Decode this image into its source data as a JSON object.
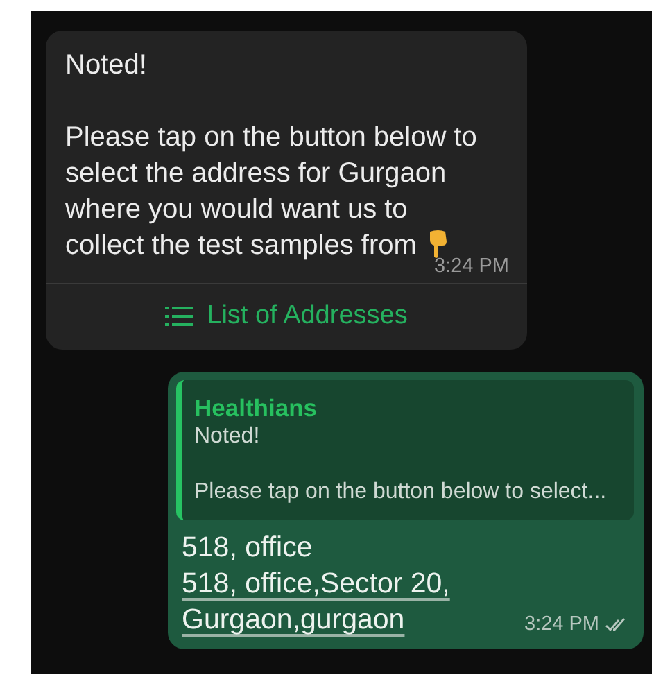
{
  "incoming": {
    "paragraphs": [
      "Noted!",
      "Please tap on the button below to select the address for Gurgaon where you would want us to collect the test samples from"
    ],
    "time": "3:24 PM",
    "button": {
      "label": "List of Addresses"
    }
  },
  "outgoing": {
    "quote": {
      "sender": "Healthians",
      "paragraphs": [
        "Noted!",
        "Please tap on the button below to select..."
      ]
    },
    "lines": [
      {
        "text": "518, office",
        "link": false
      },
      {
        "text": "518, office,Sector 20,",
        "link": true
      },
      {
        "text": "Gurgaon,gurgaon",
        "link": true
      }
    ],
    "time": "3:24 PM",
    "read": false
  }
}
